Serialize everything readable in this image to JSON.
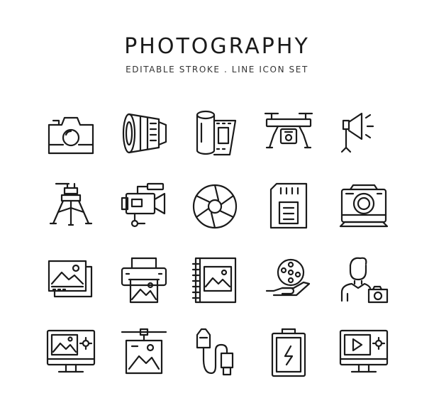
{
  "header": {
    "title": "PHOTOGRAPHY",
    "subtitle": "EDITABLE STROKE . LINE ICON SET"
  },
  "style": {
    "stroke_color": "#1a1a1a",
    "background": "#ffffff"
  },
  "icons": [
    "camera-icon",
    "lens-icon",
    "film-roll-icon",
    "drone-icon",
    "studio-light-icon",
    "tripod-icon",
    "video-camera-icon",
    "aperture-icon",
    "memory-card-icon",
    "instant-camera-icon",
    "photo-gallery-icon",
    "photo-printer-icon",
    "photo-album-icon",
    "film-reel-hand-icon",
    "photographer-icon",
    "photo-editor-monitor-icon",
    "hanging-photo-icon",
    "usb-cable-icon",
    "battery-icon",
    "video-editor-monitor-icon"
  ]
}
